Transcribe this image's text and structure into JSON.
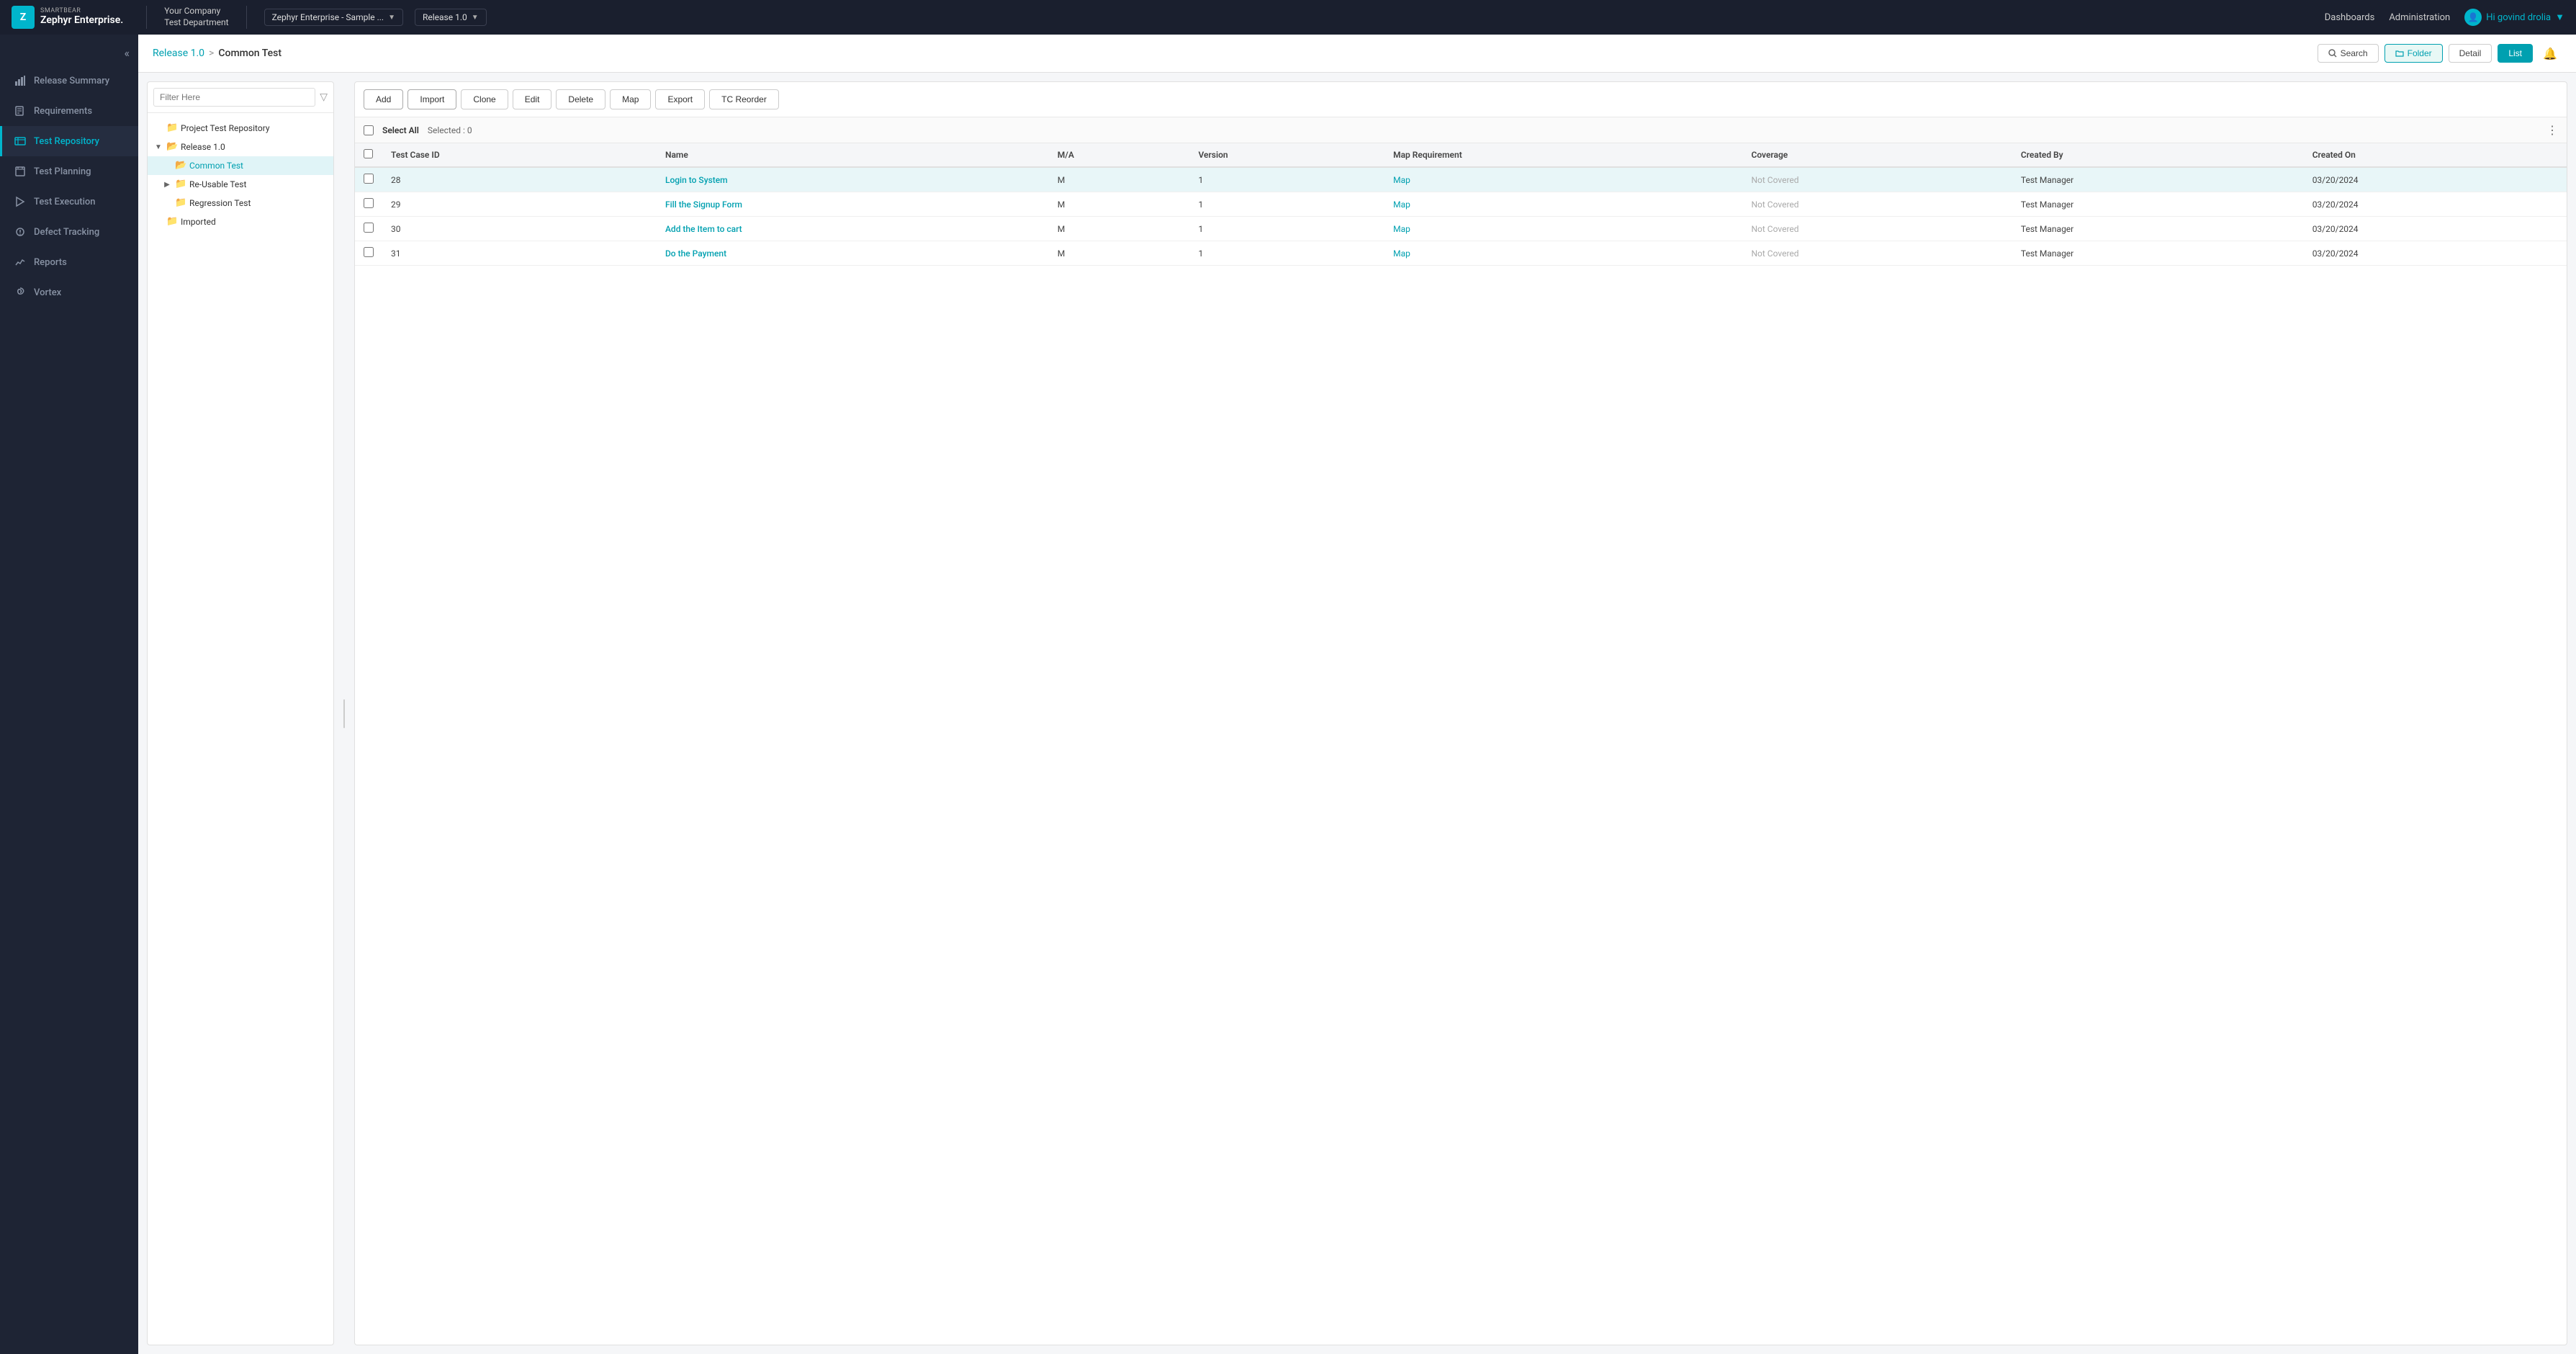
{
  "app": {
    "brand_top": "SMARTBEAR",
    "brand_bottom": "Zephyr Enterprise.",
    "logo_letter": "Z"
  },
  "topnav": {
    "company_line1": "Your Company",
    "company_line2": "Test Department",
    "project_dropdown": "Zephyr Enterprise - Sample ...",
    "release_dropdown": "Release 1.0",
    "dashboards_label": "Dashboards",
    "administration_label": "Administration",
    "user_greeting": "Hi  govind drolia",
    "user_caret": "▼"
  },
  "sidebar": {
    "collapse_icon": "«",
    "items": [
      {
        "id": "release-summary",
        "label": "Release Summary",
        "icon": "📊"
      },
      {
        "id": "requirements",
        "label": "Requirements",
        "icon": "📋"
      },
      {
        "id": "test-repository",
        "label": "Test Repository",
        "icon": "🗂️",
        "active": true
      },
      {
        "id": "test-planning",
        "label": "Test Planning",
        "icon": "📅"
      },
      {
        "id": "test-execution",
        "label": "Test Execution",
        "icon": "▶️"
      },
      {
        "id": "defect-tracking",
        "label": "Defect Tracking",
        "icon": "🐛"
      },
      {
        "id": "reports",
        "label": "Reports",
        "icon": "📈"
      },
      {
        "id": "vortex",
        "label": "Vortex",
        "icon": "🌀"
      }
    ]
  },
  "breadcrumb": {
    "release_label": "Release 1.0",
    "separator": ">",
    "current": "Common Test"
  },
  "breadcrumb_actions": {
    "search_label": "Search",
    "folder_label": "Folder",
    "detail_label": "Detail",
    "list_label": "List"
  },
  "filter": {
    "placeholder": "Filter Here"
  },
  "tree": {
    "nodes": [
      {
        "id": "project-repo",
        "label": "Project Test Repository",
        "level": 1,
        "arrow": "",
        "folder": "📁"
      },
      {
        "id": "release-1",
        "label": "Release 1.0",
        "level": 1,
        "arrow": "▼",
        "folder": "📂",
        "expanded": true
      },
      {
        "id": "common-test",
        "label": "Common Test",
        "level": 2,
        "arrow": "",
        "folder": "📂",
        "selected": true
      },
      {
        "id": "reusable-test",
        "label": "Re-Usable Test",
        "level": 2,
        "arrow": "▶",
        "folder": "📁"
      },
      {
        "id": "regression-test",
        "label": "Regression Test",
        "level": 2,
        "arrow": "",
        "folder": "📁"
      },
      {
        "id": "imported",
        "label": "Imported",
        "level": 1,
        "arrow": "",
        "folder": "📁"
      }
    ]
  },
  "toolbar": {
    "add_label": "Add",
    "import_label": "Import",
    "clone_label": "Clone",
    "edit_label": "Edit",
    "delete_label": "Delete",
    "map_label": "Map",
    "export_label": "Export",
    "tc_reorder_label": "TC Reorder"
  },
  "table": {
    "select_all_label": "Select All",
    "selected_label": "Selected : 0",
    "columns": {
      "checkbox": "",
      "test_case_id": "Test Case ID",
      "name": "Name",
      "ma": "M/A",
      "version": "Version",
      "map_requirement": "Map Requirement",
      "coverage": "Coverage",
      "created_by": "Created By",
      "created_on": "Created On"
    },
    "rows": [
      {
        "id": "28",
        "name": "Login to System",
        "ma": "M",
        "version": "1",
        "map_requirement": "Map",
        "coverage": "Not Covered",
        "created_by": "Test Manager",
        "created_on": "03/20/2024",
        "highlighted": true
      },
      {
        "id": "29",
        "name": "Fill the Signup Form",
        "ma": "M",
        "version": "1",
        "map_requirement": "Map",
        "coverage": "Not Covered",
        "created_by": "Test Manager",
        "created_on": "03/20/2024",
        "highlighted": false
      },
      {
        "id": "30",
        "name": "Add the Item to cart",
        "ma": "M",
        "version": "1",
        "map_requirement": "Map",
        "coverage": "Not Covered",
        "created_by": "Test Manager",
        "created_on": "03/20/2024",
        "highlighted": false
      },
      {
        "id": "31",
        "name": "Do the Payment",
        "ma": "M",
        "version": "1",
        "map_requirement": "Map",
        "coverage": "Not Covered",
        "created_by": "Test Manager",
        "created_on": "03/20/2024",
        "highlighted": false
      }
    ]
  }
}
